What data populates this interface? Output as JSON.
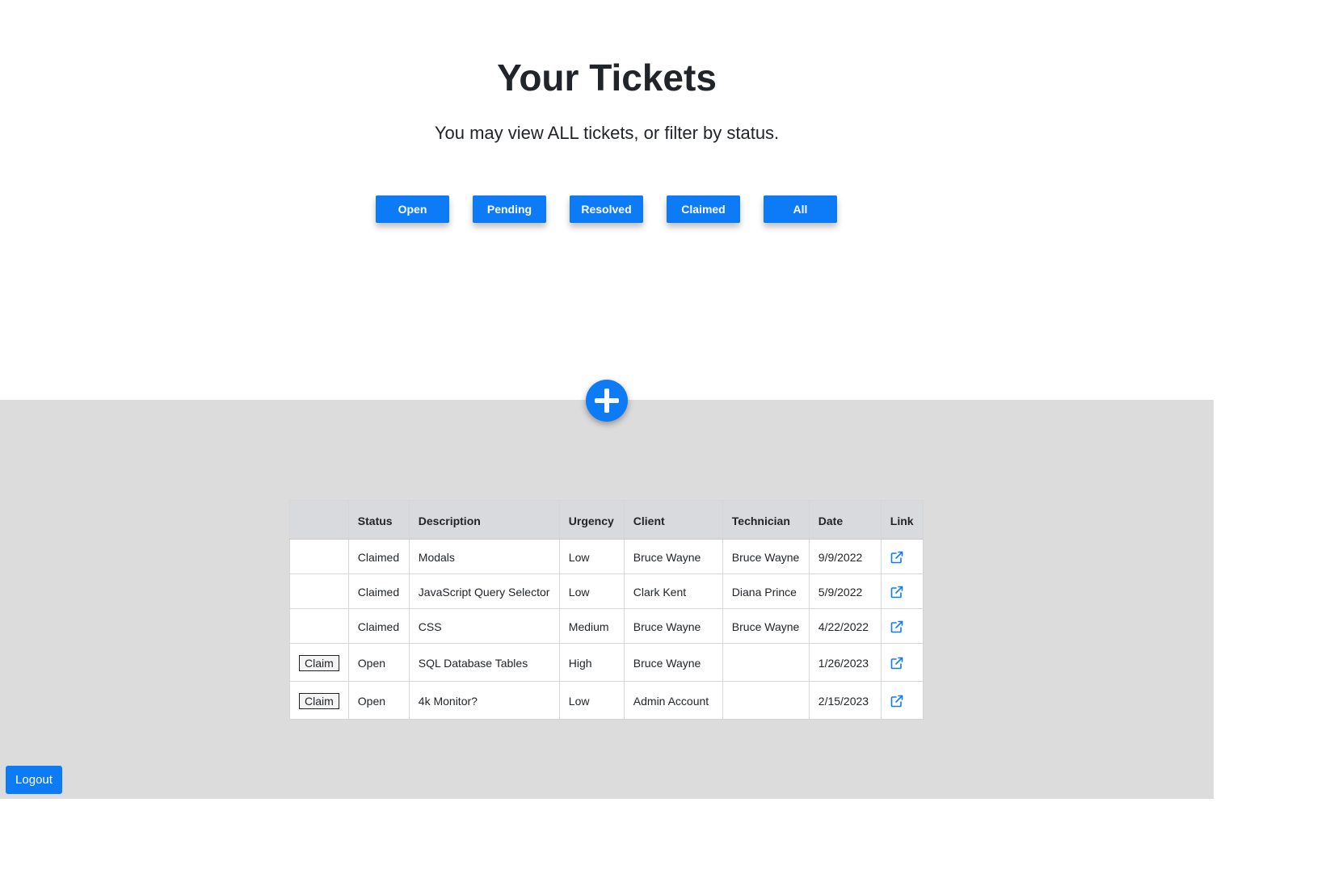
{
  "header": {
    "title": "Your Tickets",
    "subtitle": "You may view ALL tickets, or filter by status."
  },
  "filters": [
    {
      "label": "Open"
    },
    {
      "label": "Pending"
    },
    {
      "label": "Resolved"
    },
    {
      "label": "Claimed"
    },
    {
      "label": "All"
    }
  ],
  "add_button": {
    "icon": "plus-circle-icon"
  },
  "table": {
    "columns": [
      "",
      "Status",
      "Description",
      "Urgency",
      "Client",
      "Technician",
      "Date",
      "Link"
    ],
    "rows": [
      {
        "claim": "",
        "status": "Claimed",
        "description": "Modals",
        "urgency": "Low",
        "client": "Bruce Wayne",
        "technician": "Bruce Wayne",
        "date": "9/9/2022",
        "link_icon": "external-link-icon"
      },
      {
        "claim": "",
        "status": "Claimed",
        "description": "JavaScript Query Selector",
        "urgency": "Low",
        "client": "Clark Kent",
        "technician": "Diana Prince",
        "date": "5/9/2022",
        "link_icon": "external-link-icon"
      },
      {
        "claim": "",
        "status": "Claimed",
        "description": "CSS",
        "urgency": "Medium",
        "client": "Bruce Wayne",
        "technician": "Bruce Wayne",
        "date": "4/22/2022",
        "link_icon": "external-link-icon"
      },
      {
        "claim": "Claim",
        "status": "Open",
        "description": "SQL Database Tables",
        "urgency": "High",
        "client": "Bruce Wayne",
        "technician": "",
        "date": "1/26/2023",
        "link_icon": "external-link-icon"
      },
      {
        "claim": "Claim",
        "status": "Open",
        "description": "4k Monitor?",
        "urgency": "Low",
        "client": "Admin Account",
        "technician": "",
        "date": "2/15/2023",
        "link_icon": "external-link-icon"
      }
    ]
  },
  "logout": {
    "label": "Logout"
  },
  "colors": {
    "accent": "#0d7bf5",
    "panel_background": "#dcdcdd",
    "table_header_background": "#d9dadd"
  }
}
